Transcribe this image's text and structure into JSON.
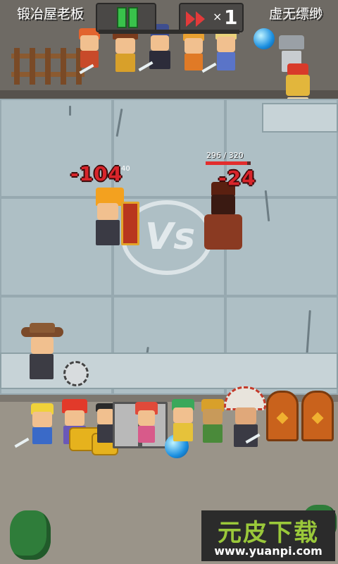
{
  "header": {
    "player_left": "锻冶屋老板",
    "player_right": "虚无缥缈",
    "speed_multiplier_symbol": "×",
    "speed_multiplier_value": "1"
  },
  "battle": {
    "enemy_hp_text": "296 / 320",
    "enemy_hp_fraction": 0.925,
    "damage_left": "-104",
    "damage_right": "-24",
    "side_hp_text": "40",
    "vs_label": "Vs"
  },
  "icons": {
    "pause": "pause-icon",
    "fast_forward": "fast-forward-icon"
  },
  "colors": {
    "pause_green": "#39c24b",
    "speed_red": "#e23a3a",
    "damage_red": "#d8252b"
  },
  "watermark": {
    "title": "元皮下载",
    "url": "www.yuanpi.com"
  }
}
